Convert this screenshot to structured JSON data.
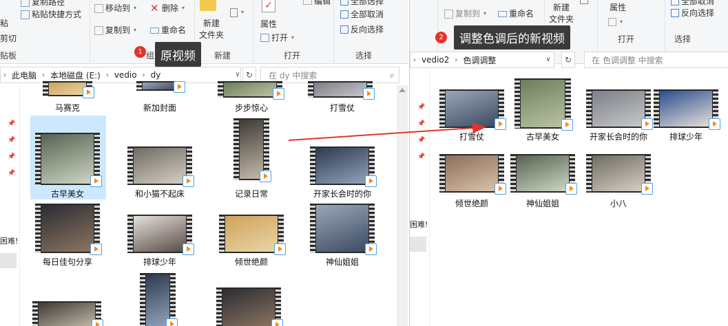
{
  "left_ribbon": {
    "copy_path": "复制路径",
    "paste_shortcut": "粘贴快捷方式",
    "paste_partial": "粘",
    "cut_partial": "剪切",
    "clipboard_partial": "贴板",
    "move_to": "移动到",
    "copy_to": "复制到",
    "delete": "删除",
    "rename": "重命名",
    "organize_partial": "组",
    "new_folder": "新建\n文件夹",
    "new_group": "新建",
    "properties": "属性",
    "open": "打开",
    "edit": "编辑",
    "open_group": "打开",
    "select_all": "全部选择",
    "select_none": "全部取消",
    "invert_selection": "反向选择",
    "select_group": "选择"
  },
  "right_ribbon": {
    "copy_to": "复制到",
    "rename": "重命名",
    "new_folder": "新建\n文件夹",
    "properties": "属性",
    "open_group": "打开",
    "select_none": "全部取消",
    "invert_selection": "反向选择",
    "select_group": "选择"
  },
  "left_address": {
    "crumbs": [
      "此电脑",
      "本地磁盘 (E:)",
      "vedio",
      "dy"
    ],
    "search_placeholder": "在 dy 中搜索"
  },
  "right_address": {
    "crumbs": [
      "vedio2",
      "色调调整"
    ],
    "search_placeholder": "在 色调调整 中搜索"
  },
  "left_nav": {
    "partial_text": "困难!"
  },
  "right_nav": {
    "partial_text": "困难!"
  },
  "left_files": [
    [
      "马赛克",
      "新加封面",
      "步步惊心",
      "打雪仗"
    ],
    [
      "古早美女",
      "和小猫不起床",
      "记录日常",
      "开家长会时的你"
    ],
    [
      "每日佳句分享",
      "排球少年",
      "倾世绝颜",
      "神仙姐姐"
    ]
  ],
  "right_files": [
    [
      "打雪仗",
      "古早美女",
      "开家长会时的你",
      "排球少年"
    ],
    [
      "倾世绝颜",
      "神仙姐姐",
      "小八"
    ]
  ],
  "callouts": {
    "one": {
      "num": "1",
      "text": "原视频"
    },
    "two": {
      "num": "2",
      "text": "调整色调后的新视频"
    }
  },
  "colors": {
    "selection": "#cce8ff",
    "callout_bg": "#3a3a3a",
    "callout_dot": "#e5332a",
    "arrow": "#e5332a"
  }
}
